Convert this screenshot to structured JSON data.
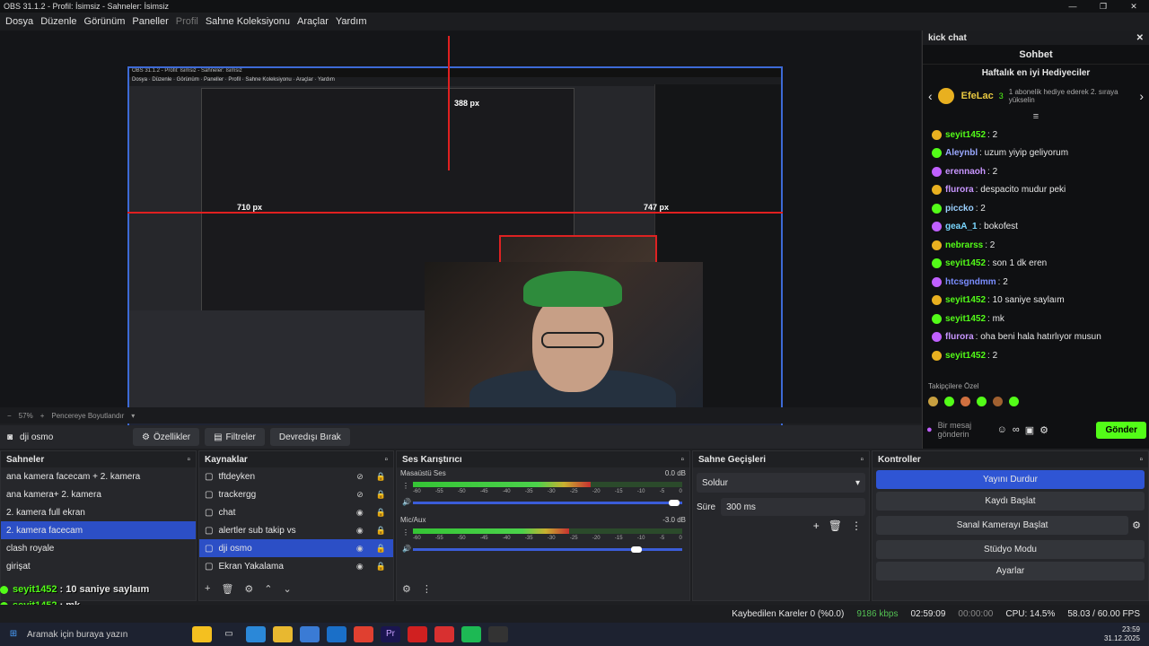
{
  "window": {
    "title": "OBS 31.1.2 - Profil: İsimsiz - Sahneler: İsimsiz",
    "min": "—",
    "max": "❐",
    "close": "✕"
  },
  "menu": [
    "Dosya",
    "Düzenle",
    "Görünüm",
    "Paneller",
    "Profil",
    "Sahne Koleksiyonu",
    "Araçlar",
    "Yardım"
  ],
  "preview": {
    "px_top": "388 px",
    "px_left": "710 px",
    "px_right": "747 px"
  },
  "zoom": {
    "level": "57%",
    "mode": "Pencereye Boyutlandır"
  },
  "source_bar": {
    "name": "dji osmo",
    "props": "Özellikler",
    "filters": "Filtreler",
    "deactivate": "Devredışı Bırak"
  },
  "scenes": {
    "title": "Sahneler",
    "items": [
      "ana kamera facecam + 2. kamera",
      "ana kamera+ 2. kamera",
      "2. kamera full ekran",
      "2. kamera  facecam",
      "clash royale",
      "girişat"
    ],
    "selected": 3
  },
  "sources": {
    "title": "Kaynaklar",
    "items": [
      {
        "name": "tftdeyken",
        "hidden": true
      },
      {
        "name": "trackergg",
        "hidden": true
      },
      {
        "name": "chat",
        "hidden": false
      },
      {
        "name": "alertler sub takip vs",
        "hidden": false
      },
      {
        "name": "dji osmo",
        "hidden": false
      },
      {
        "name": "Ekran Yakalama",
        "hidden": false
      }
    ],
    "selected": 4
  },
  "mixer": {
    "title": "Ses Karıştırıcı",
    "channels": [
      {
        "name": "Masaüstü Ses",
        "db": "0.0 dB",
        "level": 0.66,
        "volume": 0.97
      },
      {
        "name": "Mic/Aux",
        "db": "-3.0 dB",
        "level": 0.58,
        "volume": 0.83
      }
    ],
    "scale": [
      "-60",
      "-55",
      "-50",
      "-45",
      "-40",
      "-35",
      "-30",
      "-25",
      "-20",
      "-15",
      "-10",
      "-5",
      "0"
    ]
  },
  "transitions": {
    "title": "Sahne Geçişleri",
    "type": "Soldur",
    "duration_label": "Süre",
    "duration": "300 ms"
  },
  "controls": {
    "title": "Kontroller",
    "buttons": [
      "Yayını Durdur",
      "Kaydı Başlat",
      "Sanal Kamerayı Başlat",
      "Stüdyo Modu",
      "Ayarlar"
    ]
  },
  "status": {
    "dropped": "Kaybedilen Kareler 0 (%0.0)",
    "bitrate": "9186 kbps",
    "stream_time": "02:59:09",
    "rec_time": "00:00:00",
    "cpu": "CPU: 14.5%",
    "fps": "58.03 / 60.00 FPS"
  },
  "chat": {
    "panel_title": "kick chat",
    "header": "Sohbet",
    "top_title": "Haftalık en iyi Hediyeciler",
    "top_user": "EfeLac",
    "top_count": "3",
    "top_note": "1 abonelik hediye ederek 2. sıraya yükselin",
    "messages": [
      {
        "user": "seyit1452",
        "text": ": 2",
        "color": "#53fc18"
      },
      {
        "user": "Aleynbl",
        "text": ": uzum yiyip geliyorum",
        "color": "#9aa8ff"
      },
      {
        "user": "erennaoh",
        "text": ": 2",
        "color": "#c896ff"
      },
      {
        "user": "flurora",
        "text": ": despacito mudur peki",
        "color": "#c896ff"
      },
      {
        "user": "piccko",
        "text": ": 2",
        "color": "#9ad0ff"
      },
      {
        "user": "geaA_1",
        "text": ": bokofest",
        "color": "#7ad7ff"
      },
      {
        "user": "nebrarss",
        "text": ": 2",
        "color": "#53fc18"
      },
      {
        "user": "seyit1452",
        "text": ": son 1 dk eren",
        "color": "#53fc18"
      },
      {
        "user": "htcsgndmm",
        "text": ": 2",
        "color": "#7a8dff"
      },
      {
        "user": "seyit1452",
        "text": ": 10 saniye saylaım",
        "color": "#53fc18"
      },
      {
        "user": "seyit1452",
        "text": ": mk",
        "color": "#53fc18"
      },
      {
        "user": "flurora",
        "text": ": oha beni hala hatırlıyor musun",
        "color": "#c896ff"
      },
      {
        "user": "seyit1452",
        "text": ": 2",
        "color": "#53fc18"
      }
    ],
    "emotes_label": "Takipçilere Özel",
    "input_placeholder": "Bir mesaj gönderin",
    "send": "Gönder"
  },
  "overlay_chat": [
    {
      "user": "seyit1452",
      "text": ": 10 saniye saylaım",
      "color": "#53fc18"
    },
    {
      "user": "seyit1452",
      "text": ": mk",
      "color": "#53fc18"
    },
    {
      "user": "flurora",
      "text": ": oha beni hala hatırlıyor musun",
      "color": "#c896ff"
    },
    {
      "user": "seyit1452",
      "text": ": 2",
      "color": "#53fc18"
    }
  ],
  "taskbar": {
    "search": "Aramak için buraya yazın",
    "time": "23:59",
    "date": "31.12.2025"
  },
  "colors": {
    "accent": "#2c4fc6",
    "kick": "#53fc18",
    "red_guide": "#e02020"
  }
}
